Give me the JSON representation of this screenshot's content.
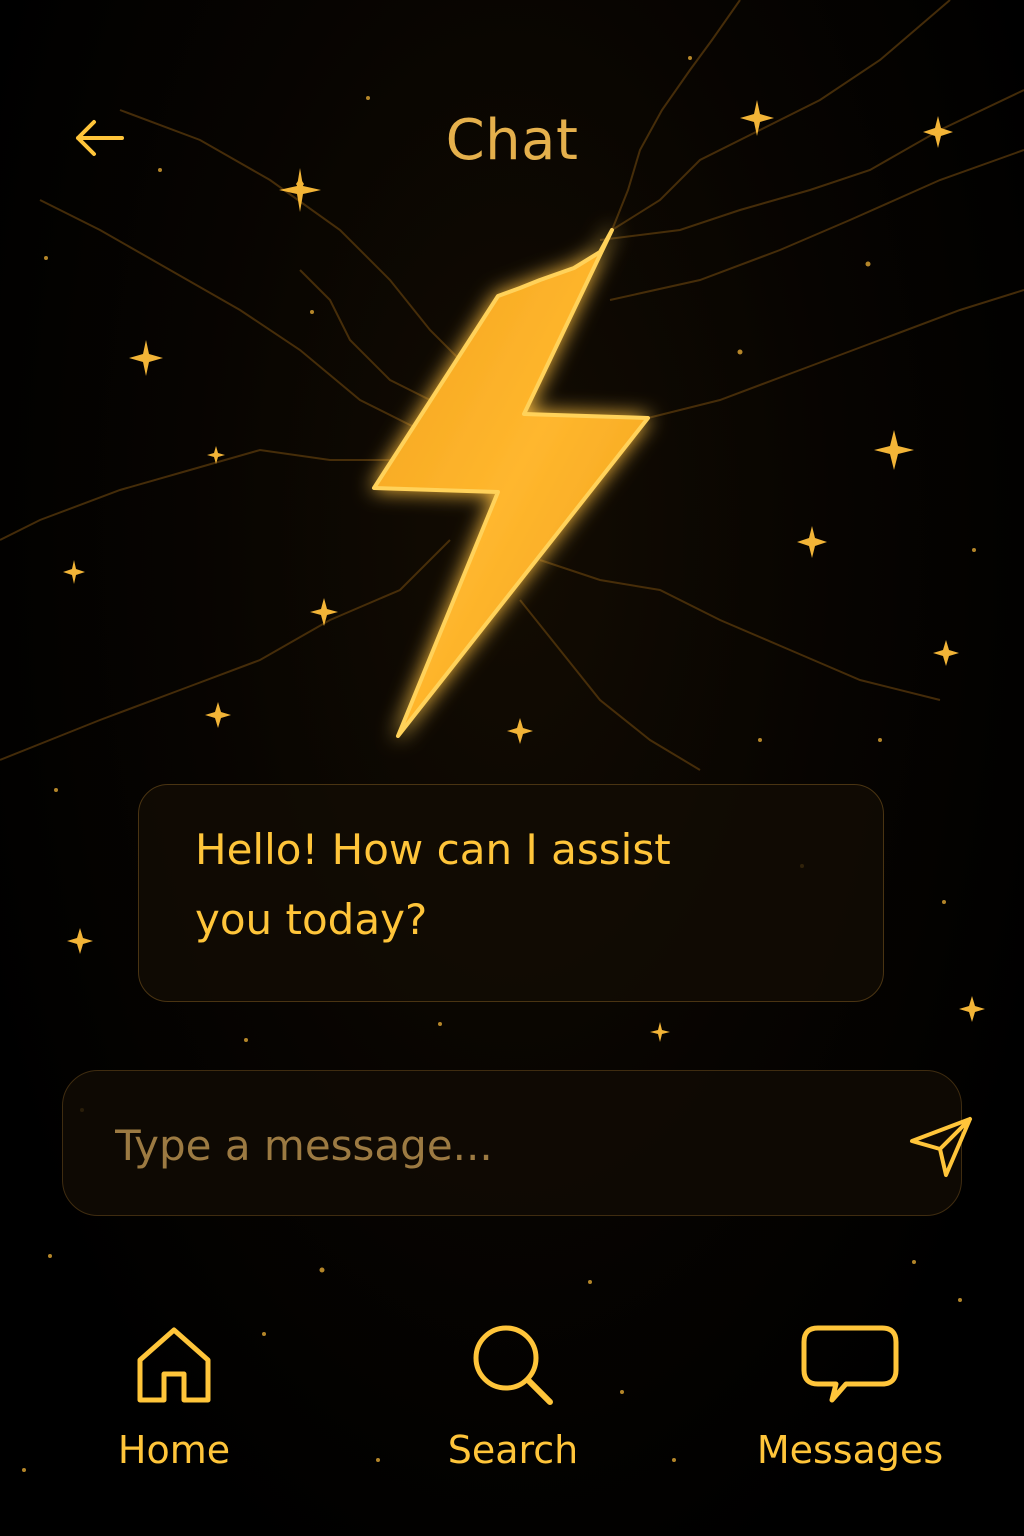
{
  "header": {
    "title": "Chat",
    "back_icon": "arrow-left-icon"
  },
  "hero": {
    "icon": "lightning-bolt-icon"
  },
  "messages": [
    {
      "from": "assistant",
      "text": "Hello! How can I assist you today?"
    }
  ],
  "composer": {
    "placeholder": "Type a message...",
    "value": "",
    "send_icon": "send-icon"
  },
  "nav": {
    "items": [
      {
        "label": "Home",
        "icon": "home-icon"
      },
      {
        "label": "Search",
        "icon": "search-icon"
      },
      {
        "label": "Messages",
        "icon": "chat-bubble-icon"
      }
    ]
  },
  "colors": {
    "accent": "#ffc53a",
    "title": "#e5b04c",
    "placeholder": "#9c7a42",
    "border": "#4a3412",
    "background": "#000000"
  }
}
